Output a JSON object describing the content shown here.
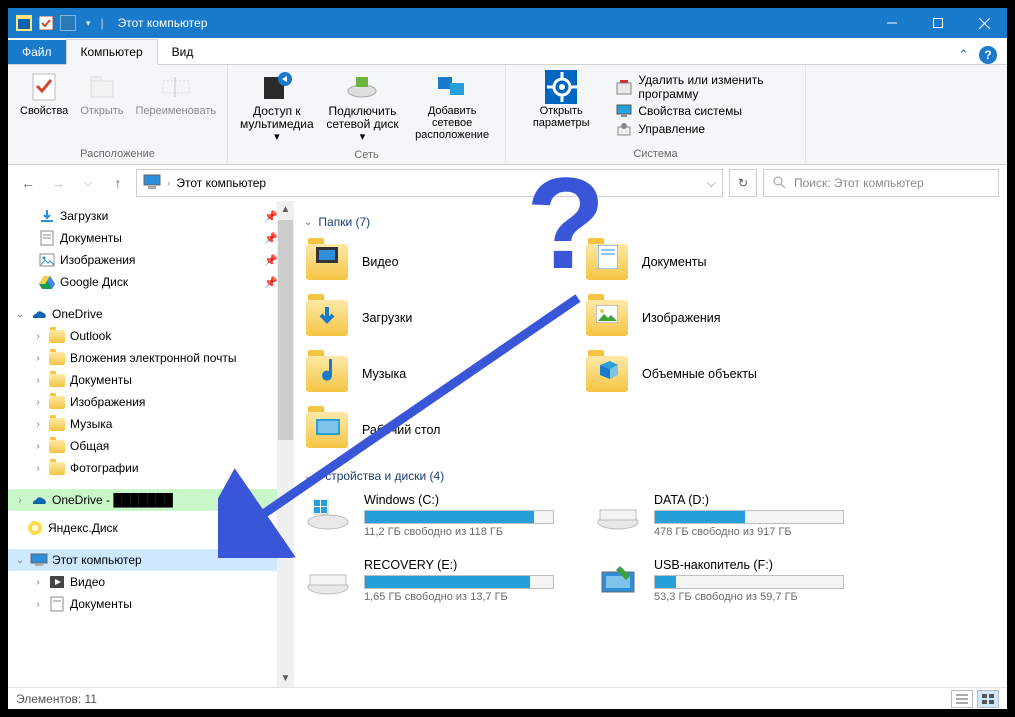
{
  "title": "Этот компьютер",
  "tabs": {
    "file": "Файл",
    "computer": "Компьютер",
    "view": "Вид"
  },
  "ribbon": {
    "location": {
      "properties": "Свойства",
      "open": "Открыть",
      "rename": "Переименовать",
      "group": "Расположение"
    },
    "network": {
      "media": "Доступ к\nмультимедиа",
      "mapdrive": "Подключить\nсетевой диск",
      "addloc": "Добавить сетевое\nрасположение",
      "group": "Сеть"
    },
    "system": {
      "settings": "Открыть\nпараметры",
      "uninstall": "Удалить или изменить программу",
      "sysprops": "Свойства системы",
      "manage": "Управление",
      "group": "Система"
    }
  },
  "address": {
    "path": "Этот компьютер"
  },
  "search": {
    "placeholder": "Поиск: Этот компьютер"
  },
  "nav": {
    "quick": [
      {
        "label": "Загрузки",
        "pin": true,
        "icon": "download"
      },
      {
        "label": "Документы",
        "pin": true,
        "icon": "doc"
      },
      {
        "label": "Изображения",
        "pin": true,
        "icon": "img"
      },
      {
        "label": "Google Диск",
        "pin": true,
        "icon": "gdrive"
      }
    ],
    "onedrive": {
      "label": "OneDrive",
      "children": [
        "Outlook",
        "Вложения электронной почты",
        "Документы",
        "Изображения",
        "Музыка",
        "Общая",
        "Фотографии"
      ]
    },
    "onedrive2": "OneDrive - ███████",
    "yandex": "Яндекс.Диск",
    "thispc": {
      "label": "Этот компьютер",
      "children": [
        "Видео",
        "Документы"
      ]
    }
  },
  "folders": {
    "heading": "Папки (7)",
    "items": [
      "Видео",
      "Документы",
      "Загрузки",
      "Изображения",
      "Музыка",
      "Объемные объекты",
      "Рабочий стол"
    ]
  },
  "drives": {
    "heading": "Устройства и диски (4)",
    "items": [
      {
        "name": "Windows (C:)",
        "sub": "11,2 ГБ свободно из 118 ГБ",
        "fill": 90
      },
      {
        "name": "DATA (D:)",
        "sub": "478 ГБ свободно из 917 ГБ",
        "fill": 48
      },
      {
        "name": "RECOVERY (E:)",
        "sub": "1,65 ГБ свободно из 13,7 ГБ",
        "fill": 88
      },
      {
        "name": "USB-накопитель (F:)",
        "sub": "53,3 ГБ свободно из 59,7 ГБ",
        "fill": 11
      }
    ]
  },
  "status": "Элементов: 11"
}
